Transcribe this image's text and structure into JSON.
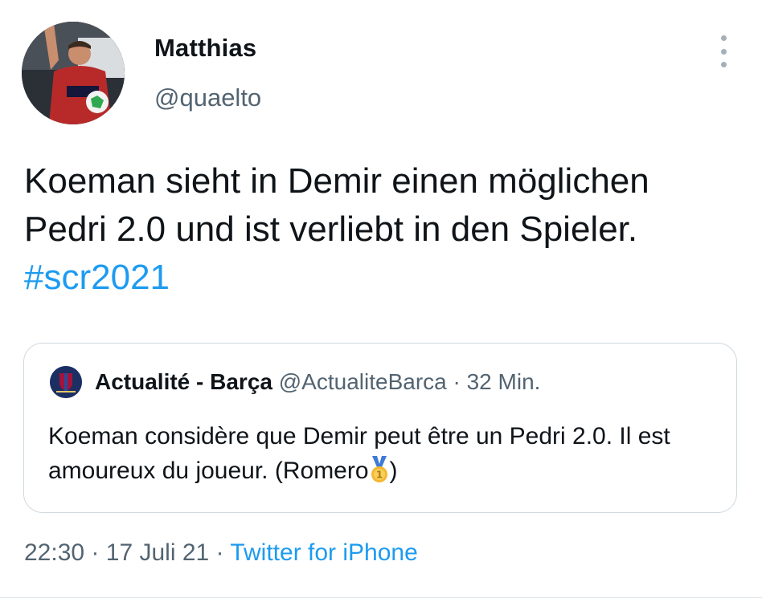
{
  "author": {
    "display_name": "Matthias",
    "handle": "@quaelto"
  },
  "tweet": {
    "text": "Koeman sieht in Demir einen möglichen Pedri 2.0 und ist verliebt in den Spieler.",
    "hashtag": "#scr2021"
  },
  "quoted_tweet": {
    "display_name": "Actualité - Barça",
    "handle": "@ActualiteBarca",
    "separator": "·",
    "time_ago": "32 Min.",
    "text": "Koeman considère que Demir peut être un Pedri 2.0. Il est amoureux du joueur. (Romero",
    "text_end": ")",
    "avatar_icon": "actualite-barca-logo"
  },
  "meta": {
    "time": "22:30",
    "separator": "·",
    "date": "17 Juli 21",
    "source": "Twitter for iPhone"
  },
  "icons": {
    "more": "more-vertical-icon",
    "medal": "gold-medal-emoji"
  },
  "colors": {
    "link": "#1d9bf0",
    "secondary": "#536471",
    "border": "#cfd9de"
  }
}
